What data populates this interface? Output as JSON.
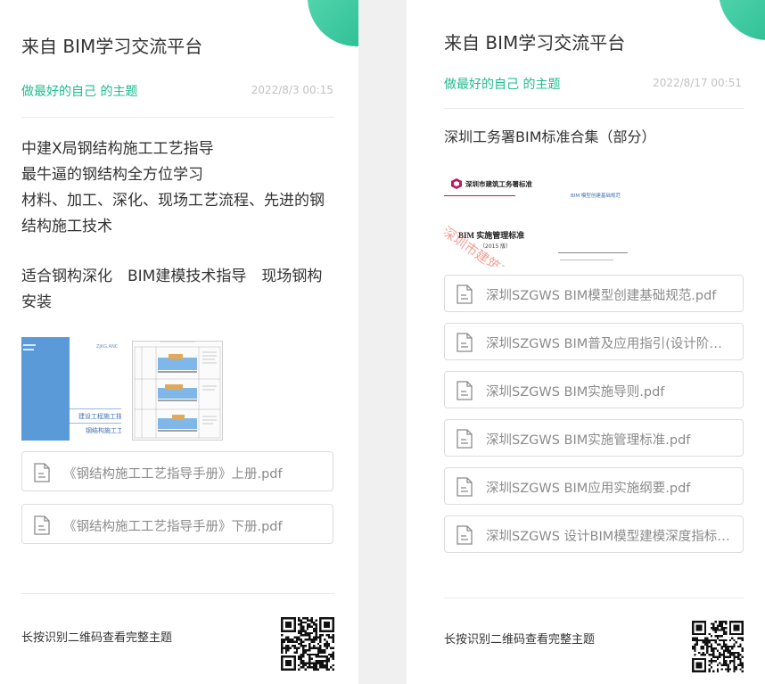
{
  "left": {
    "title": "来自 BIM学习交流平台",
    "topic": "做最好的自己 的主题",
    "date": "2022/8/3 00:15",
    "body_lines": [
      "中建X局钢结构施工工艺指导",
      "最牛逼的钢结构全方位学习",
      "材料、加工、深化、现场工艺流程、先进的钢",
      "结构施工技术",
      "适合钢构深化　BIM建模技术指导　现场钢构",
      "安装"
    ],
    "preview": {
      "cover_label_1": "建设工程施工技术与",
      "cover_label_2": "钢结构施工工艺",
      "cover_brand": "ZJKG.ANC"
    },
    "files": [
      "《钢结构施工工艺指导手册》上册.pdf",
      "《钢结构施工工艺指导手册》下册.pdf"
    ],
    "footer": "长按识别二维码查看完整主题"
  },
  "right": {
    "title": "来自 BIM学习交流平台",
    "topic": "做最好的自己 的主题",
    "date": "2022/8/17 00:51",
    "body_lines": [
      "深圳工务署BIM标准合集（部分）"
    ],
    "preview": {
      "org": "深圳市建筑工务署标准",
      "doc_title": "BIM 实施管理标准",
      "doc_year": "（2015 版）",
      "side_title": "BIM 模型创建基础规范",
      "watermark": "深圳市建筑工"
    },
    "files": [
      "深圳SZGWS BIM模型创建基础规范.pdf",
      "深圳SZGWS BIM普及应用指引(设计阶段BIM模型应用).pdf",
      "深圳SZGWS BIM实施导则.pdf",
      "深圳SZGWS BIM实施管理标准.pdf",
      "深圳SZGWS BIM应用实施纲要.pdf",
      "深圳SZGWS 设计BIM模型建模深度指标要求.pdf"
    ],
    "footer": "长按识别二维码查看完整主题"
  },
  "colors": {
    "accent": "#1fbc8f",
    "date": "#c2c2c2",
    "file_text": "#8b8b8b"
  },
  "icons": {
    "file": "document-icon",
    "qr": "qr-code",
    "corner": "decorative-circle"
  }
}
